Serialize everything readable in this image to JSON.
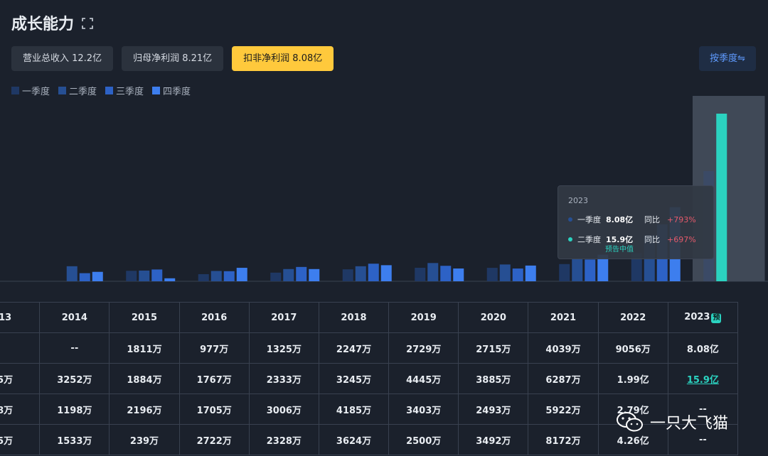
{
  "title": "成长能力",
  "tabs": [
    {
      "label": "营业总收入 12.2亿",
      "active": false
    },
    {
      "label": "归母净利润 8.21亿",
      "active": false
    },
    {
      "label": "扣非净利润 8.08亿",
      "active": true
    }
  ],
  "mode_button": "按季度⇋",
  "colors": {
    "q1": "#1f3864",
    "q2": "#264f93",
    "q3": "#2d62c6",
    "q4": "#3d7eee",
    "highlight": "#2bd2c0",
    "accent": "#ffc93c"
  },
  "legend": [
    {
      "label": "一季度",
      "color": "#1f3864"
    },
    {
      "label": "二季度",
      "color": "#264f93"
    },
    {
      "label": "三季度",
      "color": "#2d62c6"
    },
    {
      "label": "四季度",
      "color": "#3d7eee"
    }
  ],
  "tooltip": {
    "year": "2023",
    "rows": [
      {
        "name": "一季度",
        "value": "8.08亿",
        "yoy_label": "同比",
        "yoy": "+793%",
        "color": "#264f93"
      },
      {
        "name": "二季度",
        "value": "15.9亿",
        "yoy_label": "同比",
        "yoy": "+697%",
        "color": "#2bd2c0",
        "note": "预告中值"
      }
    ]
  },
  "chart_data": {
    "type": "bar",
    "unit": "万",
    "categories": [
      "13",
      "2014",
      "2015",
      "2016",
      "2017",
      "2018",
      "2019",
      "2020",
      "2021",
      "2022",
      "2023"
    ],
    "series": [
      {
        "name": "一季度",
        "values": [
          null,
          null,
          1811,
          977,
          1325,
          2247,
          2729,
          2715,
          4039,
          9056,
          80800
        ]
      },
      {
        "name": "二季度",
        "values": [
          null,
          3252,
          1884,
          1767,
          2333,
          3245,
          4445,
          3885,
          6287,
          19900,
          159000
        ]
      },
      {
        "name": "三季度",
        "values": [
          null,
          1198,
          2196,
          1705,
          3006,
          4185,
          3403,
          2493,
          5922,
          27900,
          null
        ]
      },
      {
        "name": "四季度",
        "values": [
          null,
          1533,
          239,
          2722,
          2328,
          3624,
          2500,
          3492,
          8172,
          42600,
          null
        ]
      }
    ],
    "highlight_category": "2023",
    "predicted_category": "2023"
  },
  "table": {
    "header": [
      "13",
      "2014",
      "2015",
      "2016",
      "2017",
      "2018",
      "2019",
      "2020",
      "2021",
      "2022",
      "2023"
    ],
    "pred_badge": "预",
    "rows": [
      [
        "",
        "--",
        "1811万",
        "977万",
        "1325万",
        "2247万",
        "2729万",
        "2715万",
        "4039万",
        "9056万",
        "8.08亿"
      ],
      [
        "5万",
        "3252万",
        "1884万",
        "1767万",
        "2333万",
        "3245万",
        "4445万",
        "3885万",
        "6287万",
        "1.99亿",
        "15.9亿"
      ],
      [
        "8万",
        "1198万",
        "2196万",
        "1705万",
        "3006万",
        "4185万",
        "3403万",
        "2493万",
        "5922万",
        "2.79亿",
        "--"
      ],
      [
        "5万",
        "1533万",
        "239万",
        "2722万",
        "2328万",
        "3624万",
        "2500万",
        "3492万",
        "8172万",
        "4.26亿",
        "--"
      ]
    ]
  },
  "watermark": "一只大飞猫"
}
